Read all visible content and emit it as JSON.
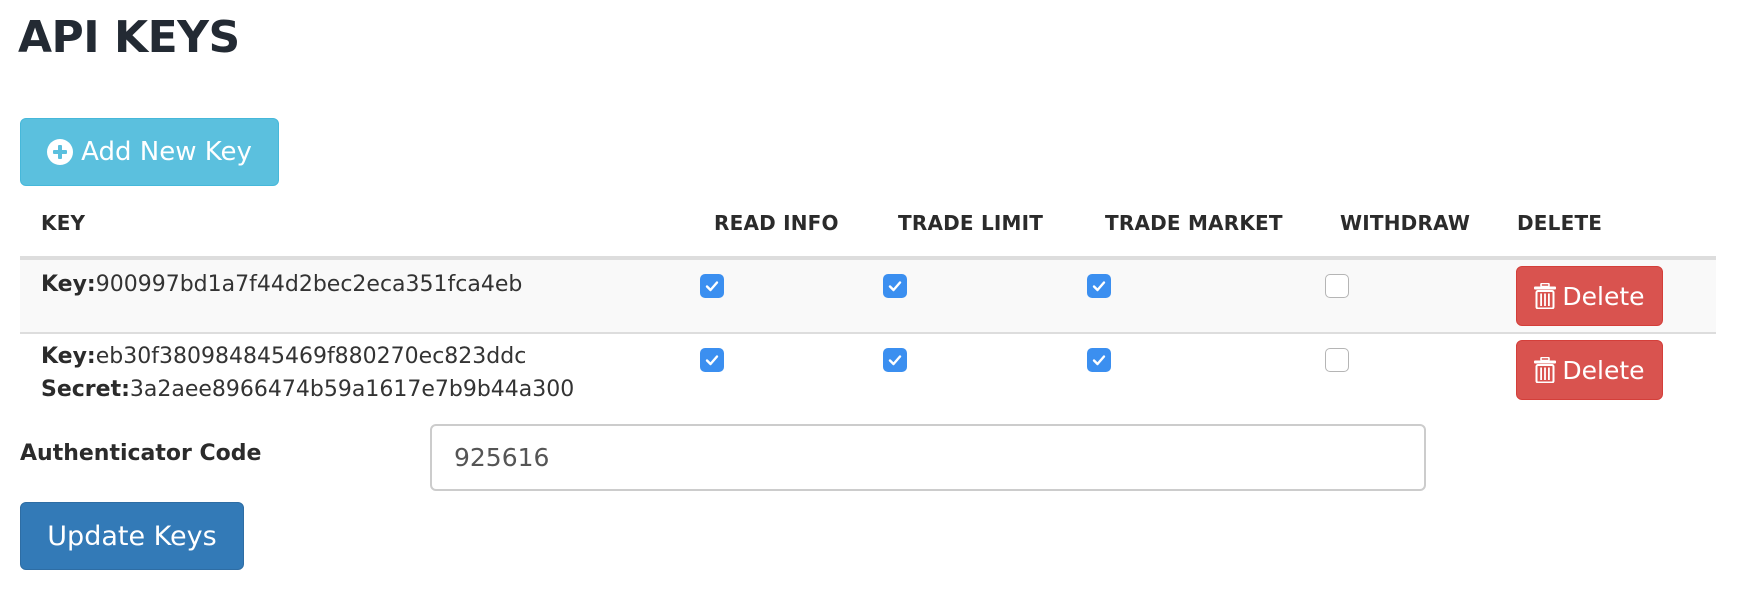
{
  "page": {
    "title": "API KEYS"
  },
  "toolbar": {
    "add_key_label": "Add New Key",
    "add_key_icon": "plus-circle-icon"
  },
  "table": {
    "columns": [
      "KEY",
      "READ INFO",
      "TRADE LIMIT",
      "TRADE MARKET",
      "WITHDRAW",
      "DELETE"
    ],
    "rows": [
      {
        "key_label": "Key:",
        "key_value": "900997bd1a7f44d2bec2eca351fca4eb",
        "read_info": true,
        "trade_limit": true,
        "trade_market": true,
        "withdraw": false,
        "delete_label": "Delete"
      },
      {
        "key_label": "Key:",
        "key_value": "eb30f380984845469f880270ec823ddc",
        "secret_label": "Secret:",
        "secret_value": "3a2aee8966474b59a1617e7b9b44a300",
        "read_info": true,
        "trade_limit": true,
        "trade_market": true,
        "withdraw": false,
        "delete_label": "Delete"
      }
    ]
  },
  "auth": {
    "label": "Authenticator Code",
    "value": "925616"
  },
  "footer": {
    "update_label": "Update Keys"
  },
  "colors": {
    "info": "#5bc0de",
    "danger": "#d9534f",
    "primary": "#337ab7",
    "checkbox": "#3b8ff0"
  }
}
